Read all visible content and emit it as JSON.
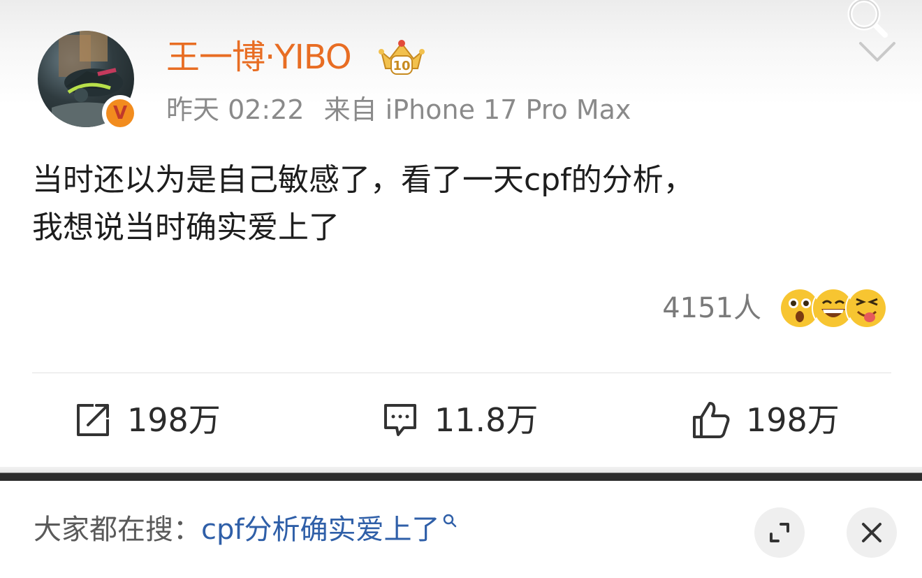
{
  "post": {
    "username": "王一博·YIBO",
    "time": "昨天 02:22",
    "source": "来自 iPhone 17 Pro Max",
    "content_line1": "当时还以为是自己敏感了，看了一天cpf的分析，",
    "content_line2": "我想说当时确实爱上了",
    "reaction_count": "4151人",
    "verified_mark": "V",
    "badge_level": "10"
  },
  "actions": {
    "repost_count": "198万",
    "comment_count": "11.8万",
    "like_count": "198万"
  },
  "bottom_bar": {
    "label": "大家都在搜：",
    "query": "cpf分析确实爱上了"
  },
  "colors": {
    "username": "#e86d23",
    "meta": "#8a8a8a",
    "link": "#2f5fa8"
  },
  "icons": {
    "search": "search-icon",
    "menu": "chevron-down-icon",
    "repost": "repost-icon",
    "comment": "comment-icon",
    "like": "thumbs-up-icon",
    "expand": "expand-icon",
    "close": "close-icon"
  }
}
